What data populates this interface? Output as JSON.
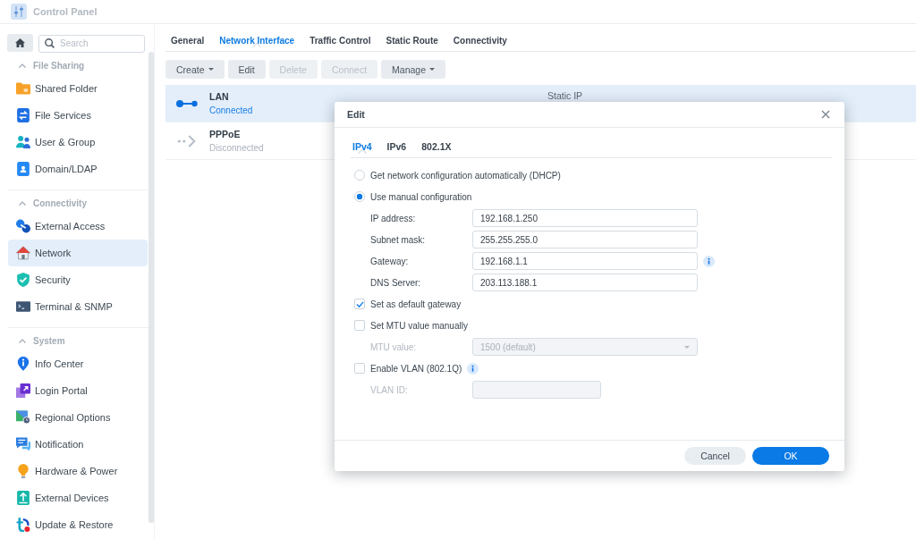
{
  "window": {
    "title": "Control Panel"
  },
  "sidebar": {
    "search": {
      "placeholder": "Search"
    },
    "sections": [
      {
        "title": "File Sharing",
        "expanded": true,
        "items": [
          {
            "label": "Shared Folder",
            "selected": false
          },
          {
            "label": "File Services",
            "selected": false
          },
          {
            "label": "User & Group",
            "selected": false
          },
          {
            "label": "Domain/LDAP",
            "selected": false
          }
        ]
      },
      {
        "title": "Connectivity",
        "expanded": true,
        "items": [
          {
            "label": "External Access",
            "selected": false
          },
          {
            "label": "Network",
            "selected": true
          },
          {
            "label": "Security",
            "selected": false
          },
          {
            "label": "Terminal & SNMP",
            "selected": false
          }
        ]
      },
      {
        "title": "System",
        "expanded": true,
        "items": [
          {
            "label": "Info Center",
            "selected": false
          },
          {
            "label": "Login Portal",
            "selected": false
          },
          {
            "label": "Regional Options",
            "selected": false
          },
          {
            "label": "Notification",
            "selected": false
          },
          {
            "label": "Hardware & Power",
            "selected": false
          },
          {
            "label": "External Devices",
            "selected": false
          },
          {
            "label": "Update & Restore",
            "selected": false
          }
        ]
      }
    ]
  },
  "tabs": [
    {
      "label": "General",
      "selected": false
    },
    {
      "label": "Network Interface",
      "selected": true
    },
    {
      "label": "Traffic Control",
      "selected": false
    },
    {
      "label": "Static Route",
      "selected": false
    },
    {
      "label": "Connectivity",
      "selected": false
    }
  ],
  "toolbar": [
    {
      "label": "Create",
      "disabled": false,
      "dropdown": true
    },
    {
      "label": "Edit",
      "disabled": false,
      "dropdown": false
    },
    {
      "label": "Delete",
      "disabled": true,
      "dropdown": false
    },
    {
      "label": "Connect",
      "disabled": true,
      "dropdown": false
    },
    {
      "label": "Manage",
      "disabled": false,
      "dropdown": true
    }
  ],
  "interfaces": [
    {
      "name": "LAN",
      "status": "Connected",
      "connected": true,
      "selected": true,
      "type": "Static IP"
    },
    {
      "name": "PPPoE",
      "status": "Disconnected",
      "connected": false,
      "selected": false
    }
  ],
  "dialog": {
    "title": "Edit",
    "tabs": [
      {
        "label": "IPv4",
        "selected": true
      },
      {
        "label": "IPv6",
        "selected": false
      },
      {
        "label": "802.1X",
        "selected": false
      }
    ],
    "modes": [
      {
        "label": "Get network configuration automatically (DHCP)",
        "selected": false
      },
      {
        "label": "Use manual configuration",
        "selected": true
      }
    ],
    "fields": [
      {
        "label": "IP address:",
        "value": "192.168.1.250"
      },
      {
        "label": "Subnet mask:",
        "value": "255.255.255.0"
      },
      {
        "label": "Gateway:",
        "value": "192.168.1.1",
        "info": true
      },
      {
        "label": "DNS Server:",
        "value": "203.113.188.1"
      }
    ],
    "options": [
      {
        "kind": "checkbox",
        "label": "Set as default gateway",
        "checked": true
      },
      {
        "kind": "checkbox",
        "label": "Set MTU value manually",
        "checked": false
      },
      {
        "kind": "select",
        "label": "MTU value:",
        "value": "1500 (default)",
        "disabled": true
      },
      {
        "kind": "checkbox",
        "label": "Enable VLAN (802.1Q)",
        "checked": false,
        "info": true
      },
      {
        "kind": "text",
        "label": "VLAN ID:",
        "disabled": true
      }
    ],
    "buttons": [
      {
        "label": "Cancel",
        "kind": "secondary"
      },
      {
        "label": "OK",
        "kind": "primary"
      }
    ]
  }
}
